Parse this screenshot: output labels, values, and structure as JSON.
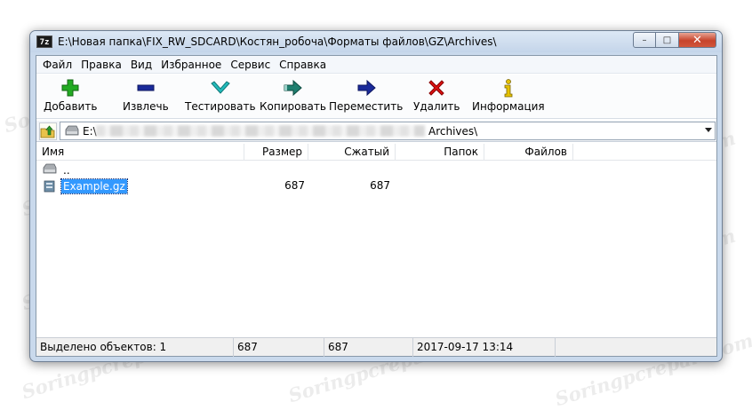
{
  "window": {
    "app_icon_text": "7z",
    "title": "E:\\Новая папка\\FIX_RW_SDCARD\\Костян_робоча\\Форматы файлов\\GZ\\Archives\\",
    "minimize": "–",
    "maximize": "□",
    "close": "✕"
  },
  "menu": {
    "file": "Файл",
    "edit": "Правка",
    "view": "Вид",
    "favorites": "Избранное",
    "tools": "Сервис",
    "help": "Справка"
  },
  "toolbar": {
    "add": "Добавить",
    "extract": "Извлечь",
    "test": "Тестировать",
    "copy": "Копировать",
    "move": "Переместить",
    "delete": "Удалить",
    "info": "Информация"
  },
  "address": {
    "path_start": "E:\\",
    "path_end": "Archives\\"
  },
  "columns": {
    "name": "Имя",
    "size": "Размер",
    "packed": "Сжатый",
    "folders": "Папок",
    "files": "Файлов"
  },
  "rows": [
    {
      "name": "..",
      "size": "",
      "packed": ""
    },
    {
      "name": "Example.gz",
      "size": "687",
      "packed": "687"
    }
  ],
  "status": {
    "selected": "Выделено объектов: 1",
    "size": "687",
    "packed": "687",
    "modified": "2017-09-17 13:14"
  },
  "watermark": "Soringpcrepair.com",
  "colors": {
    "selection": "#3399ff",
    "add_icon": "#22aa22",
    "extract_icon": "#1a2a9a",
    "test_icon": "#22bbbb",
    "copy_icon": "#1f7f6f",
    "move_icon": "#1a2a9a",
    "delete_icon": "#dd1111",
    "info_icon": "#e6c200"
  }
}
